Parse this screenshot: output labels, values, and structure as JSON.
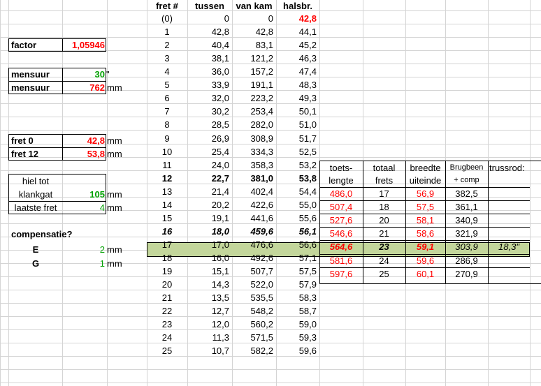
{
  "params": {
    "factor": {
      "label": "factor",
      "value": "1,05946"
    },
    "mensuur_inch": {
      "label": "mensuur",
      "value": "30",
      "unit": "\""
    },
    "mensuur_mm": {
      "label": "mensuur",
      "value": "762",
      "unit": "mm"
    },
    "fret0": {
      "label": "fret 0",
      "value": "42,8",
      "unit": "mm"
    },
    "fret12": {
      "label": "fret 12",
      "value": "53,8",
      "unit": "mm"
    },
    "hiel_line1": "hiel tot",
    "hiel_line2": "klankgat",
    "hiel_value": "105",
    "hiel_unit": "mm",
    "laatste": {
      "label": "laatste fret",
      "value": "4",
      "unit": "mm"
    },
    "compensatie": "compensatie?",
    "E": {
      "label": "E",
      "value": "2",
      "unit": "mm"
    },
    "G": {
      "label": "G",
      "value": "1",
      "unit": "mm"
    }
  },
  "fret_table": {
    "headers": [
      "fret #",
      "tussen",
      "van kam",
      "halsbr."
    ],
    "rows": [
      [
        "(0)",
        "0",
        "0",
        "42,8"
      ],
      [
        "1",
        "42,8",
        "42,8",
        "44,1"
      ],
      [
        "2",
        "40,4",
        "83,1",
        "45,2"
      ],
      [
        "3",
        "38,1",
        "121,2",
        "46,3"
      ],
      [
        "4",
        "36,0",
        "157,2",
        "47,4"
      ],
      [
        "5",
        "33,9",
        "191,1",
        "48,3"
      ],
      [
        "6",
        "32,0",
        "223,2",
        "49,3"
      ],
      [
        "7",
        "30,2",
        "253,4",
        "50,1"
      ],
      [
        "8",
        "28,5",
        "282,0",
        "51,0"
      ],
      [
        "9",
        "26,9",
        "308,9",
        "51,7"
      ],
      [
        "10",
        "25,4",
        "334,3",
        "52,5"
      ],
      [
        "11",
        "24,0",
        "358,3",
        "53,2"
      ],
      [
        "12",
        "22,7",
        "381,0",
        "53,8"
      ],
      [
        "13",
        "21,4",
        "402,4",
        "54,4"
      ],
      [
        "14",
        "20,2",
        "422,6",
        "55,0"
      ],
      [
        "15",
        "19,1",
        "441,6",
        "55,6"
      ],
      [
        "16",
        "18,0",
        "459,6",
        "56,1"
      ],
      [
        "17",
        "17,0",
        "476,6",
        "56,6"
      ],
      [
        "18",
        "16,0",
        "492,6",
        "57,1"
      ],
      [
        "19",
        "15,1",
        "507,7",
        "57,5"
      ],
      [
        "20",
        "14,3",
        "522,0",
        "57,9"
      ],
      [
        "21",
        "13,5",
        "535,5",
        "58,3"
      ],
      [
        "22",
        "12,7",
        "548,2",
        "58,7"
      ],
      [
        "23",
        "12,0",
        "560,2",
        "59,0"
      ],
      [
        "24",
        "11,3",
        "571,5",
        "59,3"
      ],
      [
        "25",
        "10,7",
        "582,2",
        "59,6"
      ]
    ]
  },
  "side_table": {
    "headers": [
      [
        "toets-",
        "lengte"
      ],
      [
        "totaal",
        "frets"
      ],
      [
        "breedte",
        "uiteinde"
      ],
      [
        "Brugbeen",
        "+ comp"
      ],
      [
        "trussrod:",
        ""
      ]
    ],
    "rows": [
      [
        "486,0",
        "17",
        "56,9",
        "382,5",
        ""
      ],
      [
        "507,4",
        "18",
        "57,5",
        "361,1",
        ""
      ],
      [
        "527,6",
        "20",
        "58,1",
        "340,9",
        ""
      ],
      [
        "546,6",
        "21",
        "58,6",
        "321,9",
        ""
      ],
      [
        "564,6",
        "23",
        "59,1",
        "303,9",
        "18,3\""
      ],
      [
        "581,6",
        "24",
        "59,6",
        "286,9",
        ""
      ],
      [
        "597,6",
        "25",
        "60,1",
        "270,9",
        ""
      ]
    ]
  },
  "colors": {
    "red": "#ff0000",
    "green": "#00a000",
    "highlight": "#c3d69b"
  }
}
